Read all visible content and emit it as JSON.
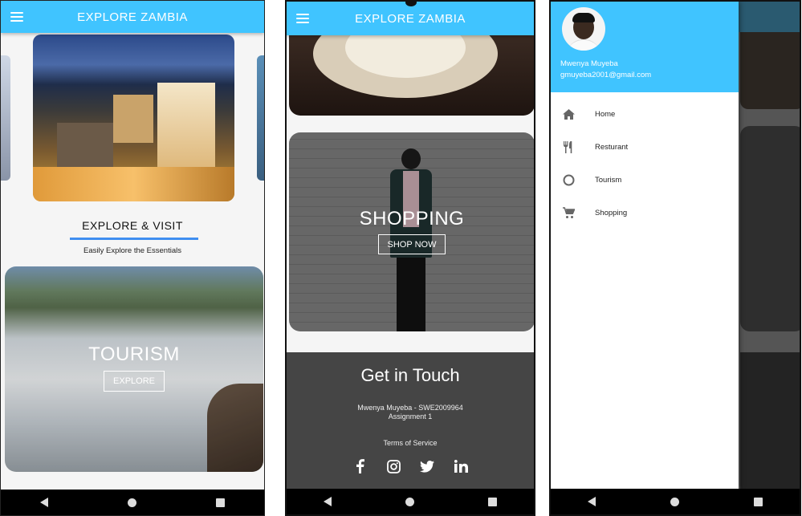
{
  "app": {
    "title": "EXPLORE ZAMBIA"
  },
  "home": {
    "section_title": "EXPLORE & VISIT",
    "section_subtitle": "Easily Explore the Essentials",
    "tourism_card": {
      "title": "TOURISM",
      "button": "EXPLORE"
    }
  },
  "screen2": {
    "shopping_card": {
      "title": "SHOPPING",
      "button": "SHOP NOW"
    },
    "footer": {
      "heading": "Get in Touch",
      "author": "Mwenya Muyeba - SWE2009964",
      "assignment": "Assignment 1",
      "terms": "Terms of Service",
      "social_icons": [
        "facebook-icon",
        "instagram-icon",
        "twitter-icon",
        "linkedin-icon"
      ]
    }
  },
  "drawer": {
    "user_name": "Mwenya Muyeba",
    "user_email": "gmuyeba2001@gmail.com",
    "items": [
      {
        "label": "Home",
        "icon": "home-icon"
      },
      {
        "label": "Resturant",
        "icon": "restaurant-icon"
      },
      {
        "label": "Tourism",
        "icon": "circle-icon"
      },
      {
        "label": "Shopping",
        "icon": "cart-icon"
      }
    ]
  },
  "colors": {
    "primary": "#40c4ff",
    "accent_line": "#3f8ef0",
    "footer_bg": "#454545"
  }
}
